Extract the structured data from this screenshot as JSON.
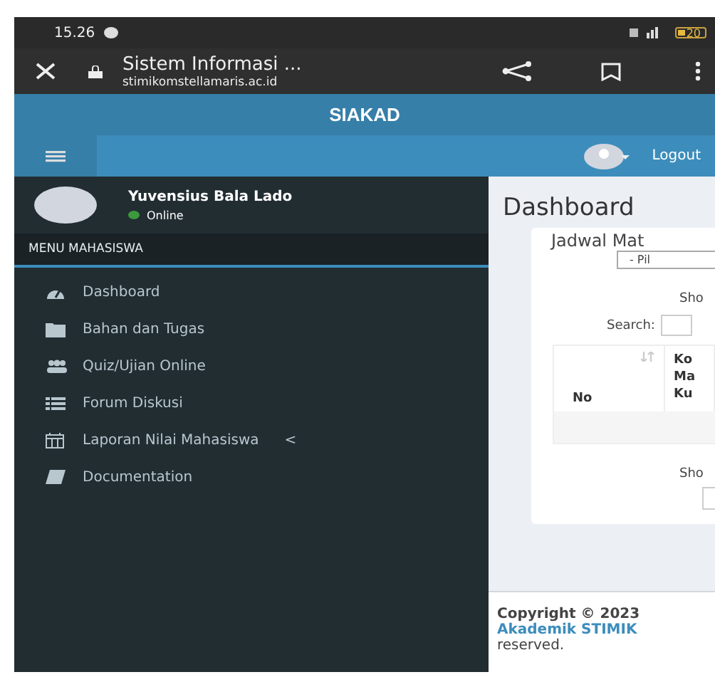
{
  "status_bar": {
    "time": "15.26",
    "battery": "20"
  },
  "browser_bar": {
    "title": "Sistem Informasi ...",
    "url": "stimikomstellamaris.ac.id"
  },
  "header": {
    "logo": "SIAKAD"
  },
  "navbar": {
    "sidebar_toggle": {
      "selected": true
    },
    "logout": "Logout"
  },
  "sidebar": {
    "user": {
      "name": "Yuvensius Bala Lado",
      "status": "Online",
      "color": "#3c9a3c"
    },
    "menu_header": "MENU MAHASISWA",
    "items": [
      {
        "label": "Dashboard"
      },
      {
        "label": "Bahan dan Tugas"
      },
      {
        "label": "Quiz/Ujian Online"
      },
      {
        "label": "Forum Diskusi"
      },
      {
        "label": "Laporan Nilai Mahasiswa",
        "caret": "<"
      },
      {
        "label": "Documentation"
      }
    ]
  },
  "content": {
    "title": "Dashboard",
    "box_title": "Jadwal Mat",
    "select": "- Pil",
    "show_top": "Sho",
    "search_label": "Search:",
    "table": {
      "columns": [
        {
          "label": "No"
        },
        {
          "label": "Ko\nMa\nKu"
        }
      ]
    },
    "show_bottom": "Sho"
  },
  "footer": {
    "copyright": "Copyright © 2023",
    "link": "Akademik STIMIK",
    "rest": "reserved."
  }
}
